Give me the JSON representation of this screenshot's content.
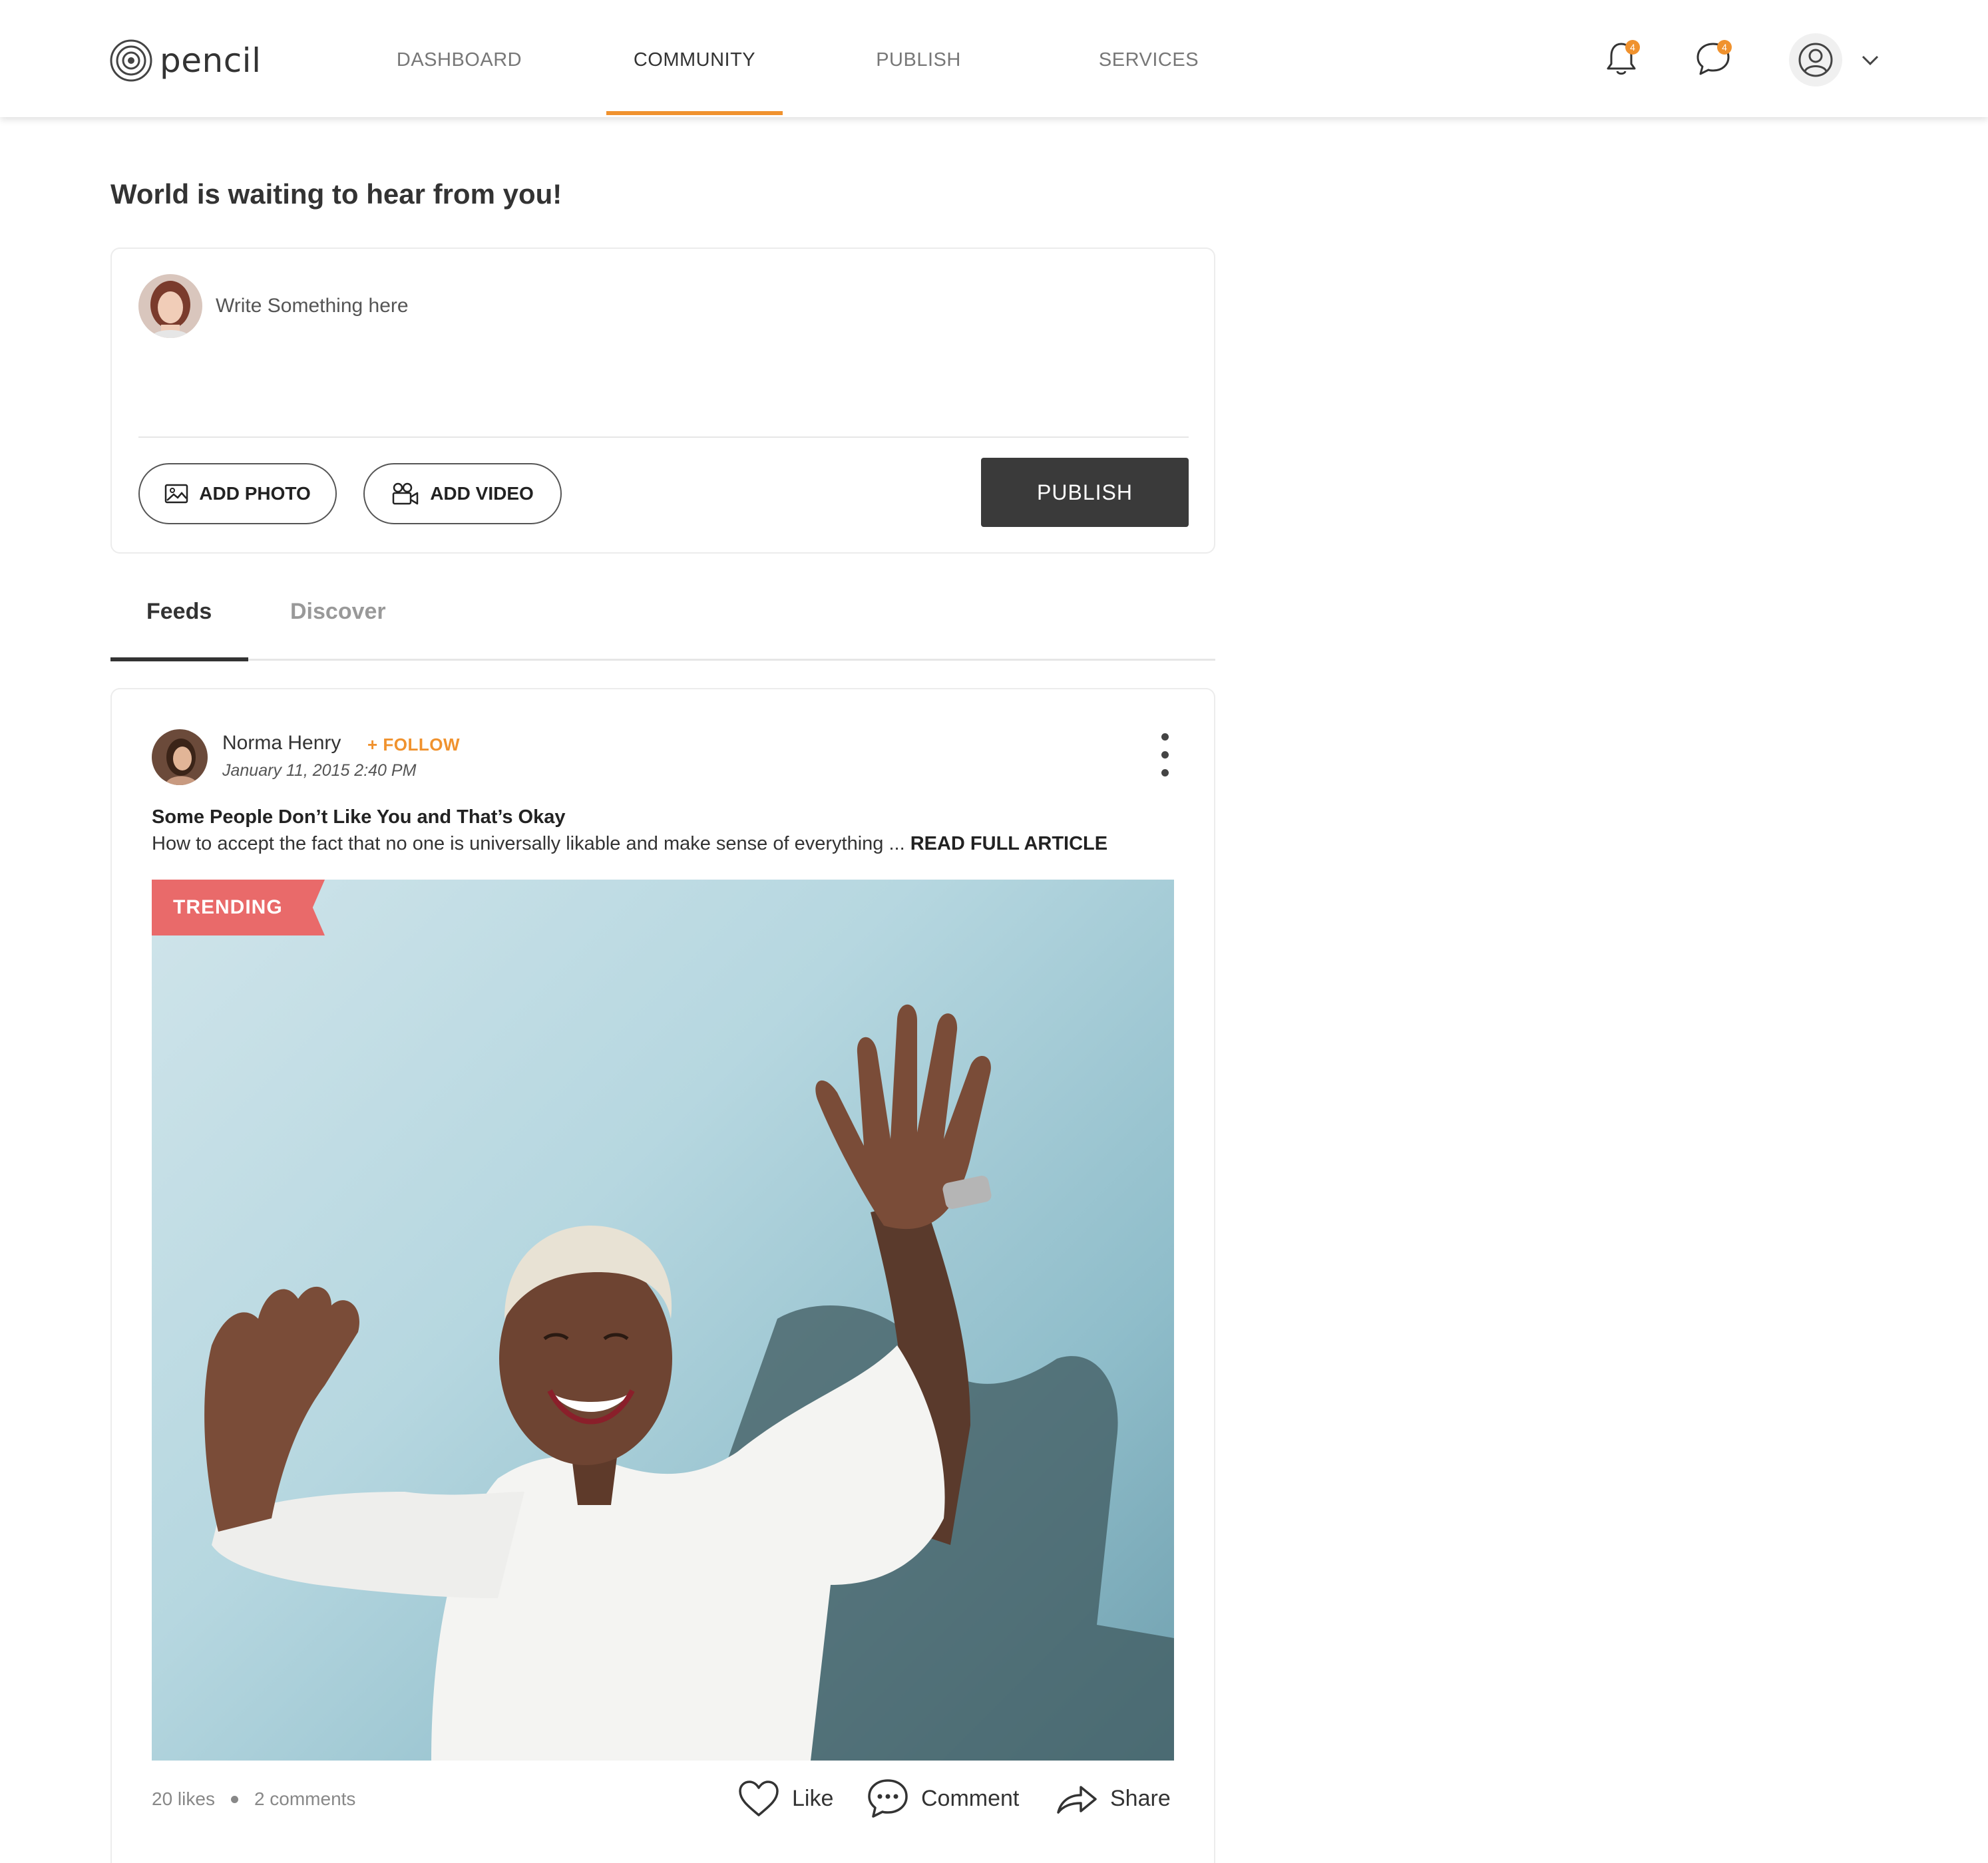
{
  "header": {
    "logo_text": "pencil",
    "nav": [
      {
        "label": "DASHBOARD"
      },
      {
        "label": "COMMUNITY",
        "active": true
      },
      {
        "label": "PUBLISH"
      },
      {
        "label": "SERVICES"
      }
    ],
    "notifications_count": "4",
    "messages_count": "4",
    "accent_color": "#f0922e"
  },
  "page": {
    "title": "World is waiting to hear from you!"
  },
  "composer": {
    "placeholder": "Write Something here",
    "add_photo_label": "ADD PHOTO",
    "add_video_label": "ADD VIDEO",
    "publish_label": "PUBLISH"
  },
  "tabs": [
    {
      "label": "Feeds",
      "active": true
    },
    {
      "label": "Discover"
    }
  ],
  "post": {
    "author": "Norma Henry",
    "follow_label": "+ FOLLOW",
    "date": "January 11, 2015 2:40 PM",
    "title": "Some People Don’t Like You and That’s Okay",
    "description": "How to accept the fact that no one is universally likable and make sense of everything ... ",
    "read_more": "READ FULL ARTICLE",
    "badge": "TRENDING",
    "badge_color": "#e96a6a",
    "likes": "20 likes",
    "comments": "2 comments",
    "actions": {
      "like": "Like",
      "comment": "Comment",
      "share": "Share"
    }
  }
}
